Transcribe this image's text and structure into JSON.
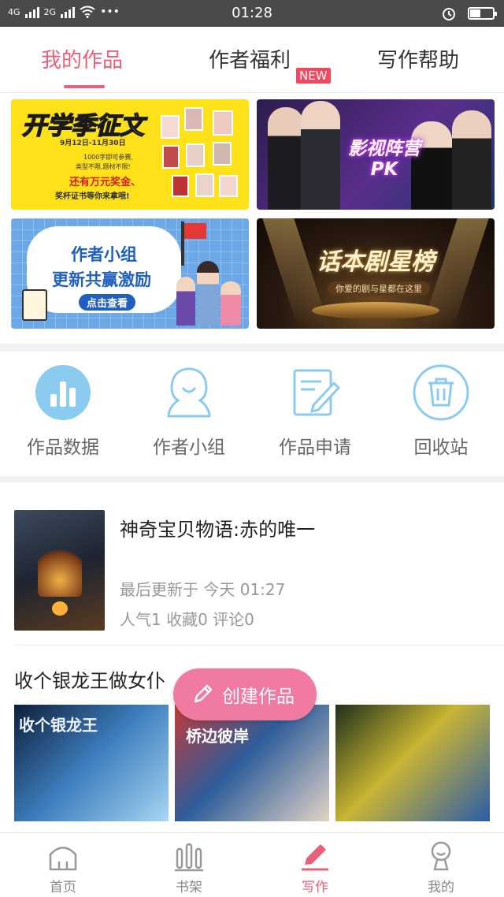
{
  "status_bar": {
    "network_1": "4G",
    "network_2": "2G",
    "more": "•••",
    "time": "01:28",
    "battery_level": 0.45
  },
  "tabs": [
    {
      "label": "我的作品",
      "active": true
    },
    {
      "label": "作者福利",
      "badge": "NEW"
    },
    {
      "label": "写作帮助"
    }
  ],
  "banners": {
    "b1": {
      "title": "开学季征文",
      "date": "9月12日-11月30日",
      "line1": "1000字即可参赛,",
      "line2": "类型不限,题材不限!",
      "line3": "还有万元奖金、",
      "line4": "奖杯证书等你来拿哦!"
    },
    "b2": {
      "title": "影视阵营PK"
    },
    "b3": {
      "title1": "作者小组",
      "title2": "更新共赢激励",
      "cta": "点击查看"
    },
    "b4": {
      "title": "话本剧星榜",
      "subtitle": "你爱的剧与星都在这里"
    }
  },
  "tools": [
    {
      "label": "作品数据",
      "icon": "bar-chart-icon"
    },
    {
      "label": "作者小组",
      "icon": "group-icon"
    },
    {
      "label": "作品申请",
      "icon": "edit-doc-icon"
    },
    {
      "label": "回收站",
      "icon": "trash-icon"
    }
  ],
  "work": {
    "title": "神奇宝贝物语:赤的唯一",
    "updated": "最后更新于 今天 01:27",
    "stats": "人气1 收藏0 评论0"
  },
  "book_title": "收个银龙王做女仆",
  "thumbs": {
    "t1": "收个银龙王",
    "t2": "桥边彼岸"
  },
  "fab": {
    "label": "创建作品"
  },
  "bottom_nav": [
    {
      "label": "首页",
      "icon": "home-icon"
    },
    {
      "label": "书架",
      "icon": "bookshelf-icon"
    },
    {
      "label": "写作",
      "icon": "pen-icon",
      "active": true
    },
    {
      "label": "我的",
      "icon": "profile-icon"
    }
  ],
  "colors": {
    "accent": "#e8607a",
    "tool_blue": "#8ccbf0",
    "fab": "#f07aa0"
  }
}
